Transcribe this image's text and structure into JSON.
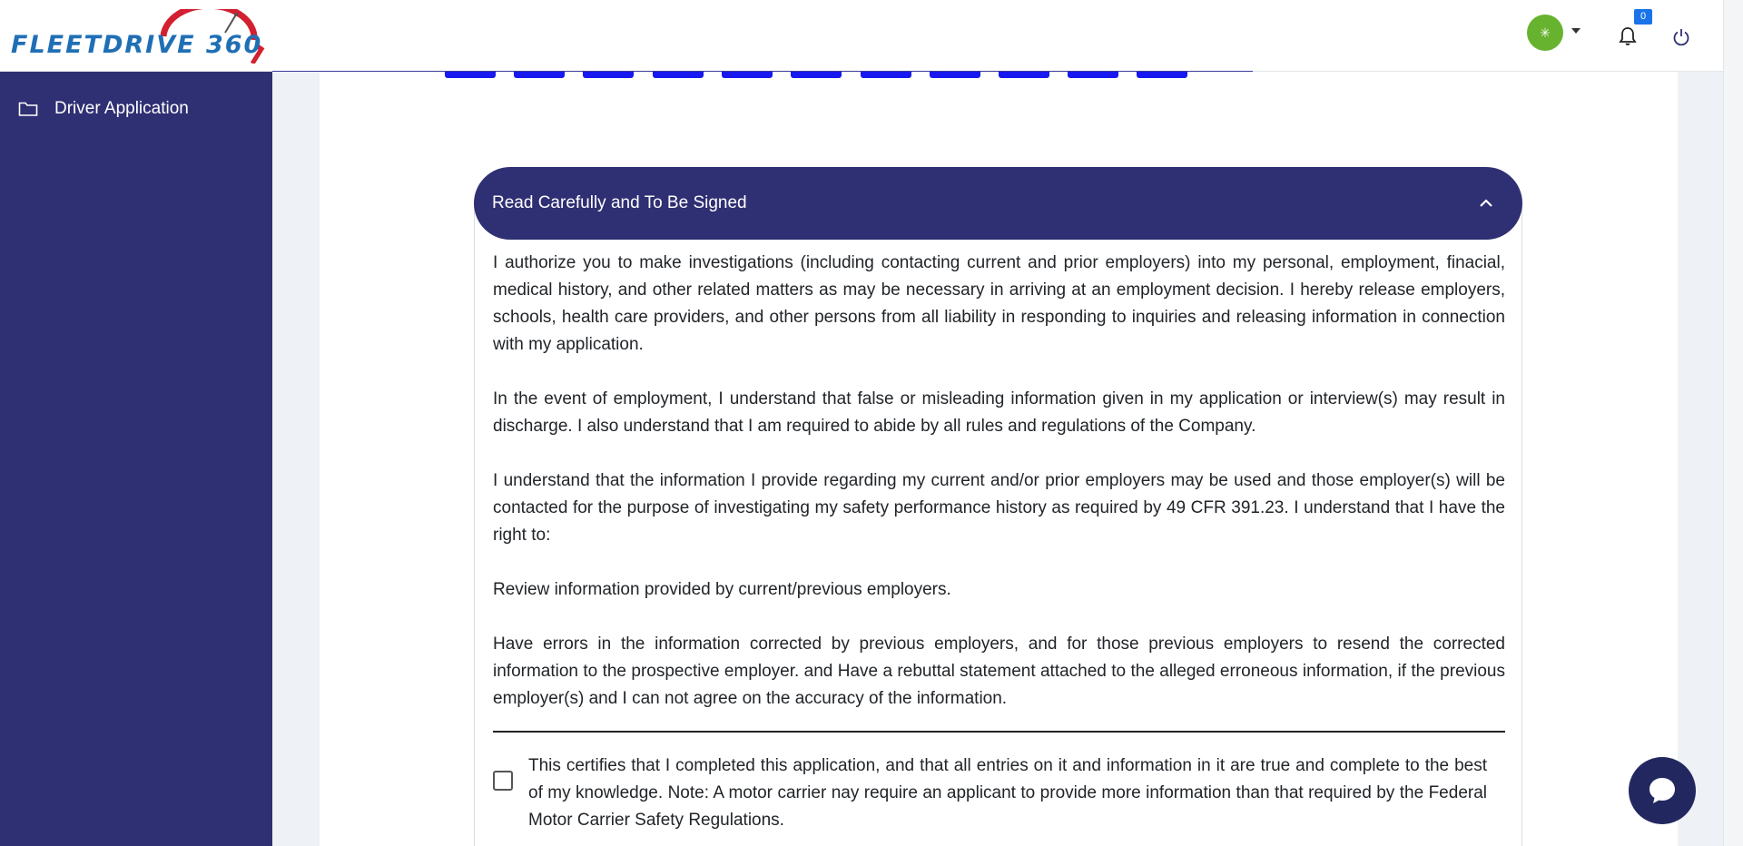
{
  "header": {
    "logo_text": "FLEETDRIVE 360",
    "avatar_glyph": "✳",
    "notification_count": "0"
  },
  "sidebar": {
    "items": [
      {
        "label": "Driver Application",
        "icon": "folder-icon"
      }
    ]
  },
  "stepper": {
    "visible_steps": 11
  },
  "section": {
    "title": "Read Carefully and To Be Signed",
    "paragraphs": [
      "I authorize you to make investigations (including contacting current and prior employers) into my personal, employment, finacial, medical history, and other related matters as may be necessary in arriving at an employment decision. I hereby release employers, schools, health care providers, and other persons from all liability in responding to inquiries and releasing information in connection with my application.",
      "In the event of employment, I understand that false or misleading information given in my application or interview(s) may result in discharge. I also understand that I am required to abide by all rules and regulations of the Company.",
      "I understand that the information I provide regarding my current and/or prior employers may be used and those employer(s) will be contacted for the purpose of investigating my safety performance history as required by 49 CFR 391.23. I understand that I have the right to:",
      "Review information provided by current/previous employers.",
      "Have errors in the information corrected by previous employers, and for those previous employers to resend the corrected information to the prospective employer. and Have a rebuttal statement attached to the alleged erroneous information, if the previous employer(s) and I can not agree on the accuracy of the information."
    ],
    "certification": "This certifies that I completed this application, and that all entries on it and information in it are true and complete to the best of my knowledge. Note: A motor carrier nay require an applicant to provide more information than that required by the Federal Motor Carrier Safety Regulations.",
    "certification_checked": false
  },
  "colors": {
    "primary": "#2f2f73",
    "avatar": "#67b330",
    "badge": "#1a73e8",
    "step_tab": "#1818f0"
  }
}
